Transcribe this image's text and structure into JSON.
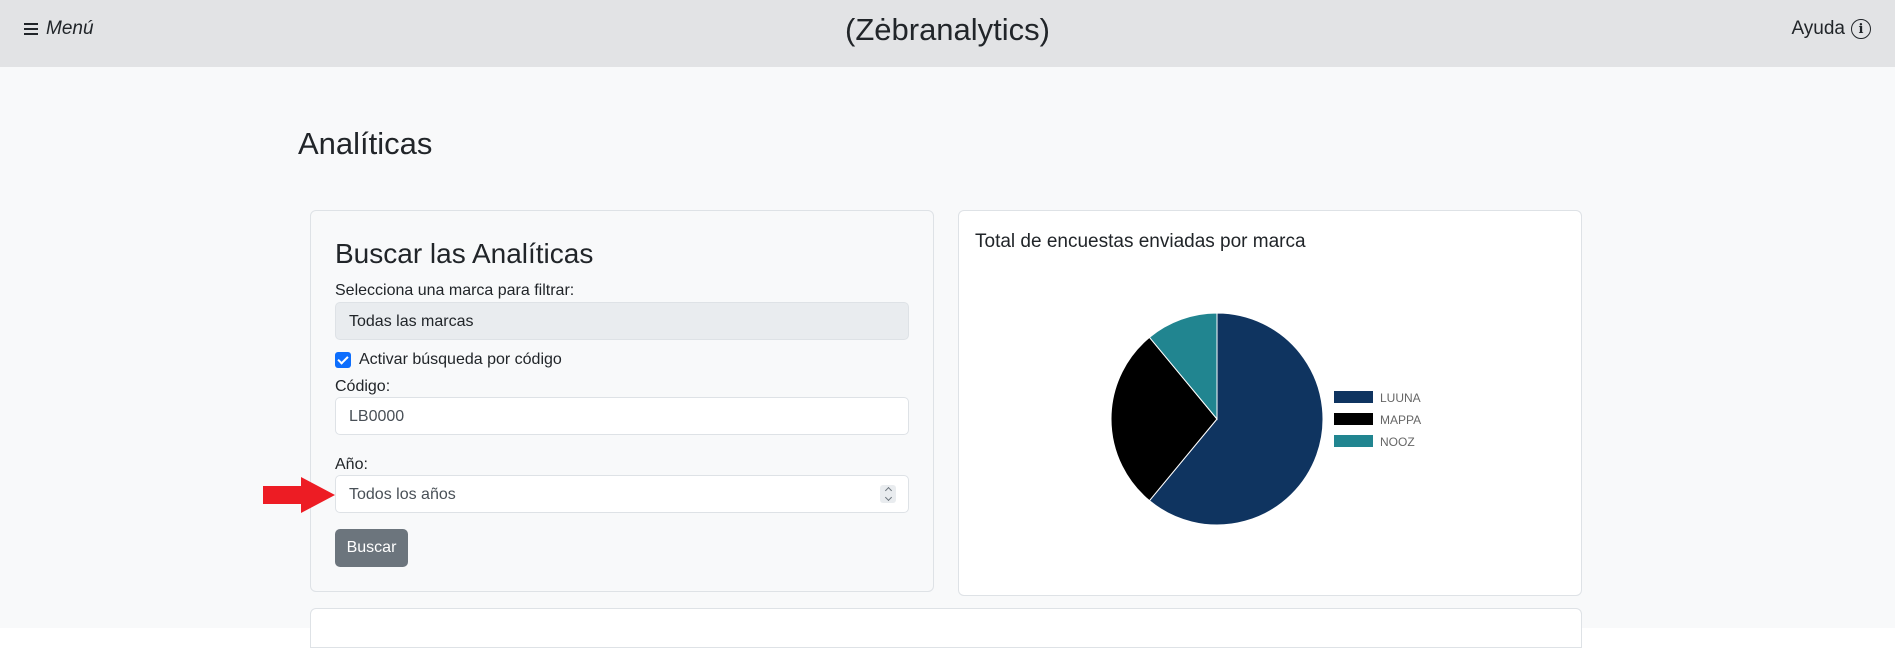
{
  "header": {
    "menu_label": "Menú",
    "app_title": "(Zėbranalytics)",
    "help_label": "Ayuda",
    "help_icon_glyph": "i"
  },
  "page": {
    "title": "Analíticas"
  },
  "search_card": {
    "title": "Buscar las Analíticas",
    "brand_label": "Selecciona una marca para filtrar:",
    "brand_value": "Todas las marcas",
    "code_search_checkbox_label": "Activar búsqueda por código",
    "code_search_checked": true,
    "code_label": "Código:",
    "code_value": "LB0000",
    "year_label": "Año:",
    "year_value": "Todos los años",
    "search_button": "Buscar"
  },
  "annotation": {
    "arrow_color": "#ed1c24"
  },
  "chart_data": {
    "type": "pie",
    "title": "Total de encuestas enviadas por marca",
    "categories": [
      "LUUNA",
      "MAPPA",
      "NOOZ"
    ],
    "values": [
      61,
      28,
      11
    ],
    "colors": [
      "#0f3460",
      "#000000",
      "#218590"
    ],
    "legend_position": "right"
  }
}
